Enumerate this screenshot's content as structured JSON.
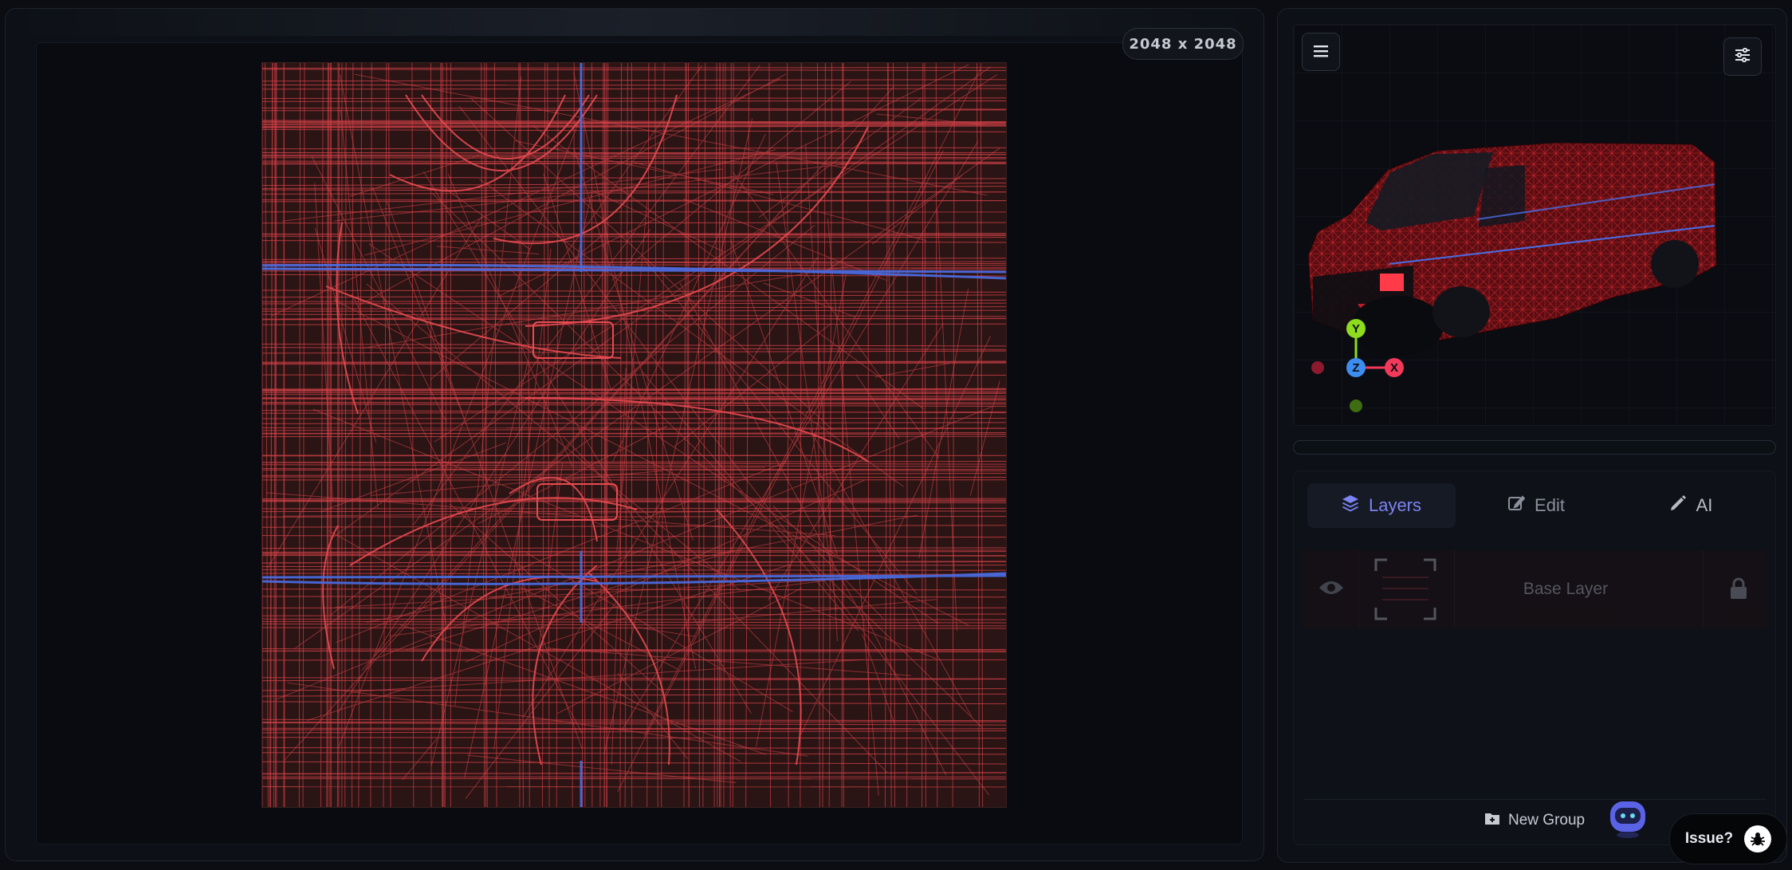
{
  "canvas": {
    "resolution_label": "2048 x 2048"
  },
  "viewport": {
    "axis": {
      "y": "Y",
      "z": "Z",
      "x": "X"
    },
    "colors": {
      "x": "#f2395a",
      "y": "#8ddc1d",
      "z": "#3d8df0"
    }
  },
  "tabs": [
    {
      "label": "Layers",
      "icon": "layers-icon",
      "active": true
    },
    {
      "label": "Edit",
      "icon": "edit-icon",
      "active": false
    },
    {
      "label": "AI",
      "icon": "pencil-icon",
      "active": false
    }
  ],
  "layers": [
    {
      "name": "Base Layer",
      "visible_icon": "eye-icon",
      "lock_icon": "lock-icon"
    }
  ],
  "footer": {
    "new_group_label": "New Group",
    "issue_label": "Issue?"
  },
  "colors": {
    "accent": "#7b84f2",
    "wire_red": "#e0454a",
    "wire_blue": "#4a6ee8",
    "canvas_bg": "#2a1414"
  }
}
